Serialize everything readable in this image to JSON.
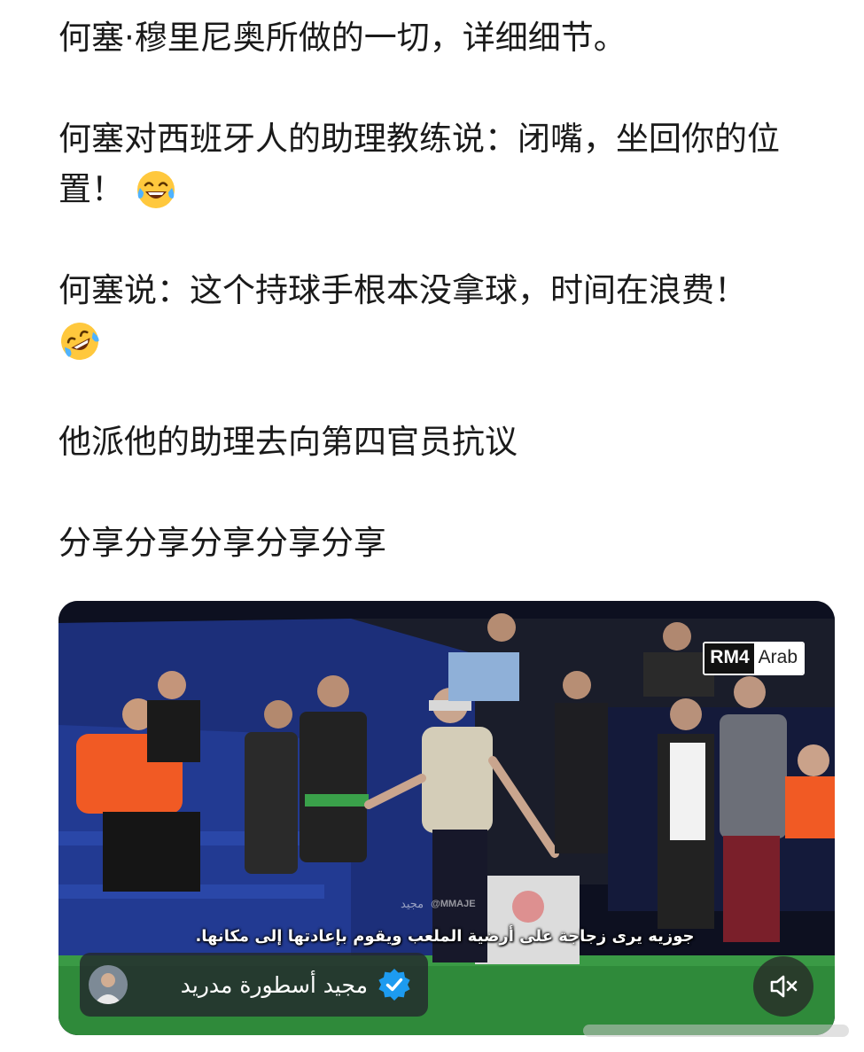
{
  "post": {
    "line1": "何塞·穆里尼奥所做的一切，详细细节。",
    "line2": "何塞对西班牙人的助理教练说：闭嘴，坐回你的位置！",
    "line3": "何塞说：这个持球手根本没拿球，时间在浪费！",
    "line4": "他派他的助理去向第四官员抗议",
    "line5": "分享分享分享分享分享",
    "emoji_1": "face-with-tears-of-joy-icon",
    "emoji_2": "rolling-on-floor-laughing-icon"
  },
  "video": {
    "brand_main": "RM4",
    "brand_sub": "Arab",
    "watermark_logo": "مجيد",
    "watermark_handle": "@MMAJE",
    "subtitle": "جوزيه يرى زجاجة على أرضية الملعب ويقوم بإعادتها إلى مكانها.",
    "account_name": "مجيد أسطورة مدريد",
    "verified_icon": "verified-check-icon",
    "mute_icon": "speaker-muted-icon"
  },
  "colors": {
    "text": "#1a1a1a",
    "verified": "#1d9bf0",
    "pitch": "#2f8a3a",
    "stand_blue": "#1f3a8a",
    "steward_vest": "#f15a24"
  }
}
